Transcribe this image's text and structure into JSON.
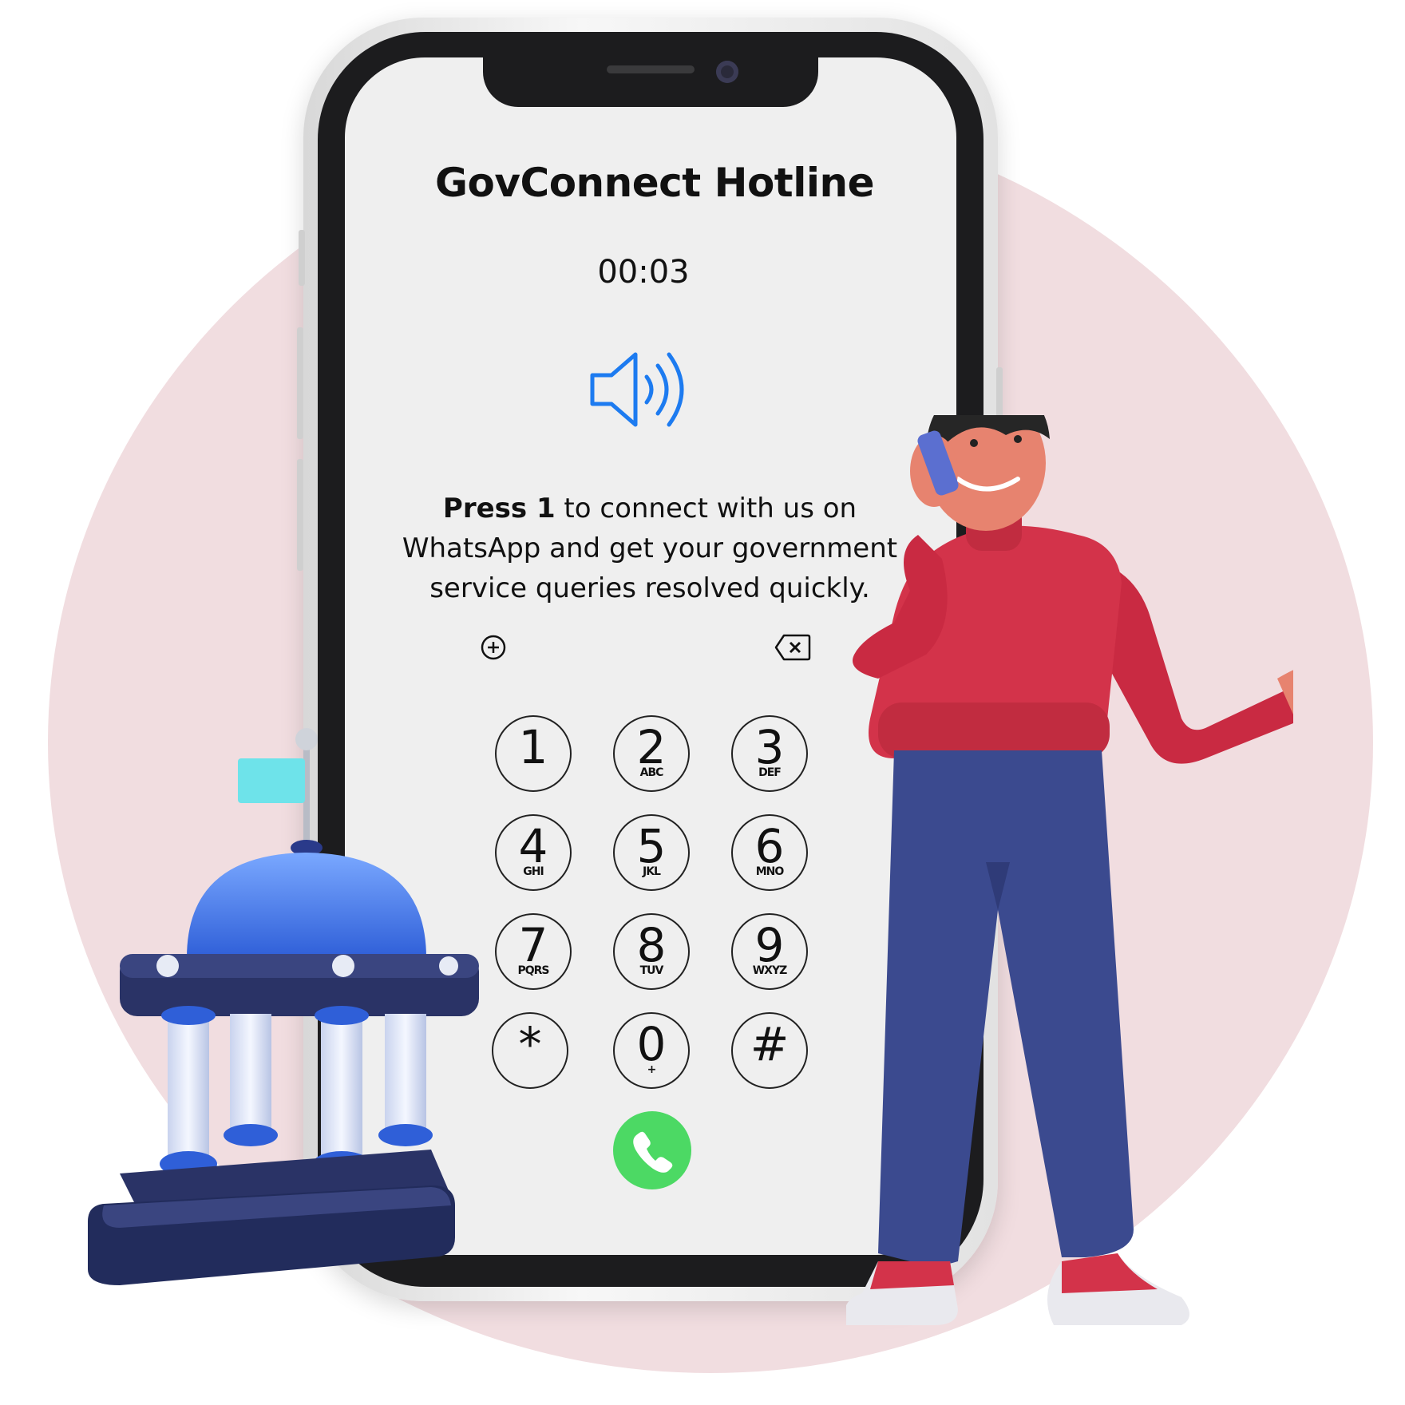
{
  "screen": {
    "title": "GovConnect Hotline",
    "timer": "00:03",
    "message_bold": "Press 1",
    "message_rest": " to connect with us on WhatsApp and get your government service queries resolved quickly."
  },
  "icons": {
    "speaker": "speaker-volume-icon",
    "add": "add-plus-icon",
    "delete": "backspace-icon",
    "call": "phone-call-icon"
  },
  "keypad": [
    {
      "digit": "1",
      "letters": ""
    },
    {
      "digit": "2",
      "letters": "ABC"
    },
    {
      "digit": "3",
      "letters": "DEF"
    },
    {
      "digit": "4",
      "letters": "GHI"
    },
    {
      "digit": "5",
      "letters": "JKL"
    },
    {
      "digit": "6",
      "letters": "MNO"
    },
    {
      "digit": "7",
      "letters": "PQRS"
    },
    {
      "digit": "8",
      "letters": "TUV"
    },
    {
      "digit": "9",
      "letters": "WXYZ"
    },
    {
      "digit": "*",
      "letters": ""
    },
    {
      "digit": "0",
      "letters": "+"
    },
    {
      "digit": "#",
      "letters": ""
    }
  ],
  "colors": {
    "accent": "#1d7bf0",
    "call_green": "#4cd964",
    "background_circle": "#f1dde0",
    "shirt": "#d3334a",
    "pants": "#3b4a8f"
  }
}
